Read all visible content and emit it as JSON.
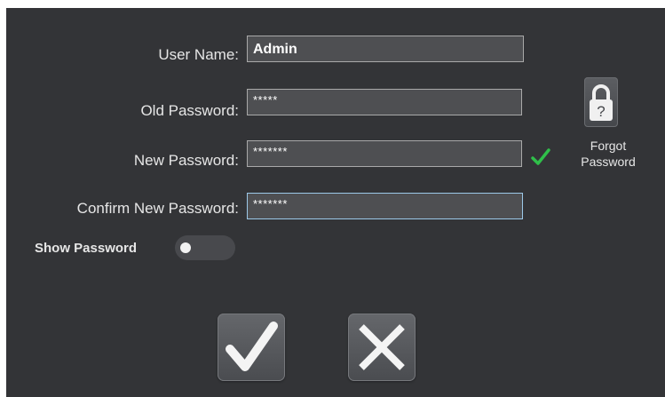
{
  "form": {
    "username": {
      "label": "User Name:",
      "value": "Admin"
    },
    "old_password": {
      "label": "Old Password:",
      "value": "*****"
    },
    "new_password": {
      "label": "New Password:",
      "value": "*******",
      "valid": true
    },
    "confirm_password": {
      "label": "Confirm New Password:",
      "value": "*******"
    }
  },
  "forgot": {
    "line1": "Forgot",
    "line2": "Password",
    "icon": "padlock-question-icon"
  },
  "show_password": {
    "label": "Show Password",
    "enabled": false
  },
  "actions": {
    "confirm_icon": "checkmark-icon",
    "cancel_icon": "close-icon"
  },
  "colors": {
    "background": "#333437",
    "input": "#4e4f52",
    "valid": "#2fbf4a",
    "text": "#e6e6e6"
  }
}
